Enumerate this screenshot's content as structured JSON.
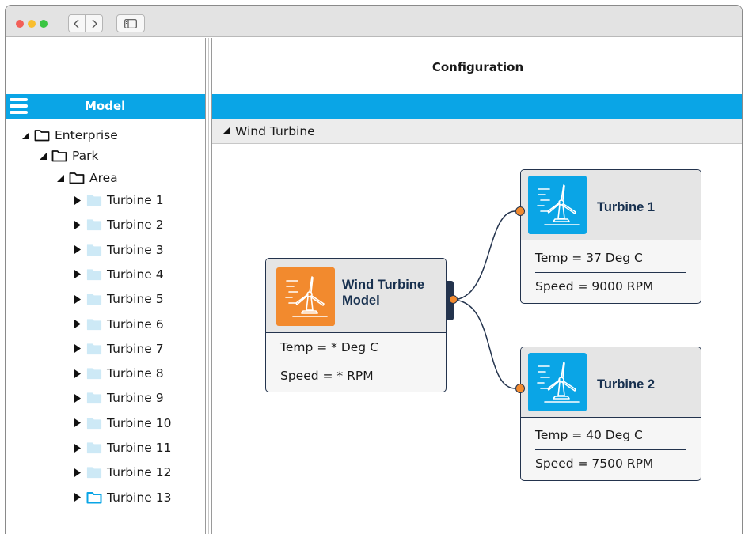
{
  "window": {
    "traffic_lights": [
      "close",
      "minimize",
      "zoom"
    ],
    "nav_icons": [
      "chevron-left-icon",
      "chevron-right-icon"
    ],
    "sidebar_toggle_icon": "sidebar-icon"
  },
  "sidebar": {
    "header_title": "Model",
    "menu_icon": "hamburger-icon",
    "tree": [
      {
        "label": "Enterprise",
        "depth": 0,
        "expanded": true,
        "folder": "outline"
      },
      {
        "label": "Park",
        "depth": 1,
        "expanded": true,
        "folder": "outline"
      },
      {
        "label": "Area",
        "depth": 2,
        "expanded": true,
        "folder": "outline"
      },
      {
        "label": "Turbine 1",
        "depth": 3,
        "expanded": false,
        "folder": "light"
      },
      {
        "label": "Turbine 2",
        "depth": 3,
        "expanded": false,
        "folder": "light"
      },
      {
        "label": "Turbine 3",
        "depth": 3,
        "expanded": false,
        "folder": "light"
      },
      {
        "label": "Turbine 4",
        "depth": 3,
        "expanded": false,
        "folder": "light"
      },
      {
        "label": "Turbine 5",
        "depth": 3,
        "expanded": false,
        "folder": "light"
      },
      {
        "label": "Turbine 6",
        "depth": 3,
        "expanded": false,
        "folder": "light"
      },
      {
        "label": "Turbine 7",
        "depth": 3,
        "expanded": false,
        "folder": "light"
      },
      {
        "label": "Turbine 8",
        "depth": 3,
        "expanded": false,
        "folder": "light"
      },
      {
        "label": "Turbine 9",
        "depth": 3,
        "expanded": false,
        "folder": "light"
      },
      {
        "label": "Turbine 10",
        "depth": 3,
        "expanded": false,
        "folder": "light"
      },
      {
        "label": "Turbine 11",
        "depth": 3,
        "expanded": false,
        "folder": "light"
      },
      {
        "label": "Turbine 12",
        "depth": 3,
        "expanded": false,
        "folder": "light"
      },
      {
        "label": "Turbine 13",
        "depth": 3,
        "expanded": false,
        "folder": "accent"
      }
    ]
  },
  "main": {
    "title": "Configuration",
    "section_label": "Wind Turbine",
    "nodes": {
      "model": {
        "title_line1": "Wind Turbine",
        "title_line2": "Model",
        "icon": "wind-turbine-icon",
        "icon_color": "#f28a2e",
        "temp": "Temp = * Deg C",
        "speed": "Speed = * RPM"
      },
      "turbine1": {
        "title": "Turbine 1",
        "icon": "wind-turbine-icon",
        "icon_color": "#0aa5e6",
        "temp": "Temp = 37 Deg C",
        "speed": "Speed = 9000 RPM"
      },
      "turbine2": {
        "title": "Turbine 2",
        "icon": "wind-turbine-icon",
        "icon_color": "#0aa5e6",
        "temp": "Temp = 40 Deg C",
        "speed": "Speed = 7500 RPM"
      }
    }
  },
  "colors": {
    "accent_blue": "#0aa5e6",
    "orange": "#f28a2e",
    "node_border": "#23334d",
    "light_folder": "#cde9f6"
  }
}
